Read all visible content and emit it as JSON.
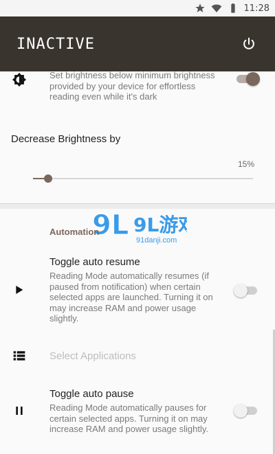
{
  "status_bar": {
    "time": "11:28",
    "icons": [
      "star-icon",
      "wifi-icon",
      "battery-icon"
    ]
  },
  "app_bar": {
    "title": "INACTIVE",
    "power_icon": "power-icon"
  },
  "brightness_option": {
    "icon": "brightness-icon",
    "description": "Set brightness below minimum brightness provided by your device for effortless reading even while it's dark",
    "enabled": true
  },
  "decrease_brightness": {
    "label": "Decrease Brightness by",
    "value_text": "15%",
    "value": 0.15
  },
  "automation": {
    "category": "Automation",
    "auto_resume": {
      "icon": "play-icon",
      "title": "Toggle auto resume",
      "description": "Reading Mode automatically resumes (if paused from notification) when certain selected apps are launched. Turning it on may increase RAM and power usage slightly.",
      "enabled": false
    },
    "select_applications": {
      "icon": "list-icon",
      "title": "Select Applications",
      "enabled": false
    },
    "auto_pause": {
      "icon": "pause-icon",
      "title": "Toggle auto pause",
      "description": "Reading Mode automatically pauses for certain selected apps. Turning it on may increase RAM and power usage slightly.",
      "enabled": false
    }
  },
  "watermark": {
    "logo_text": "9L游戏",
    "site_text": "91danji.com"
  },
  "colors": {
    "app_bar": "#3a342f",
    "accent": "#7a675c",
    "background": "#fafafa"
  }
}
